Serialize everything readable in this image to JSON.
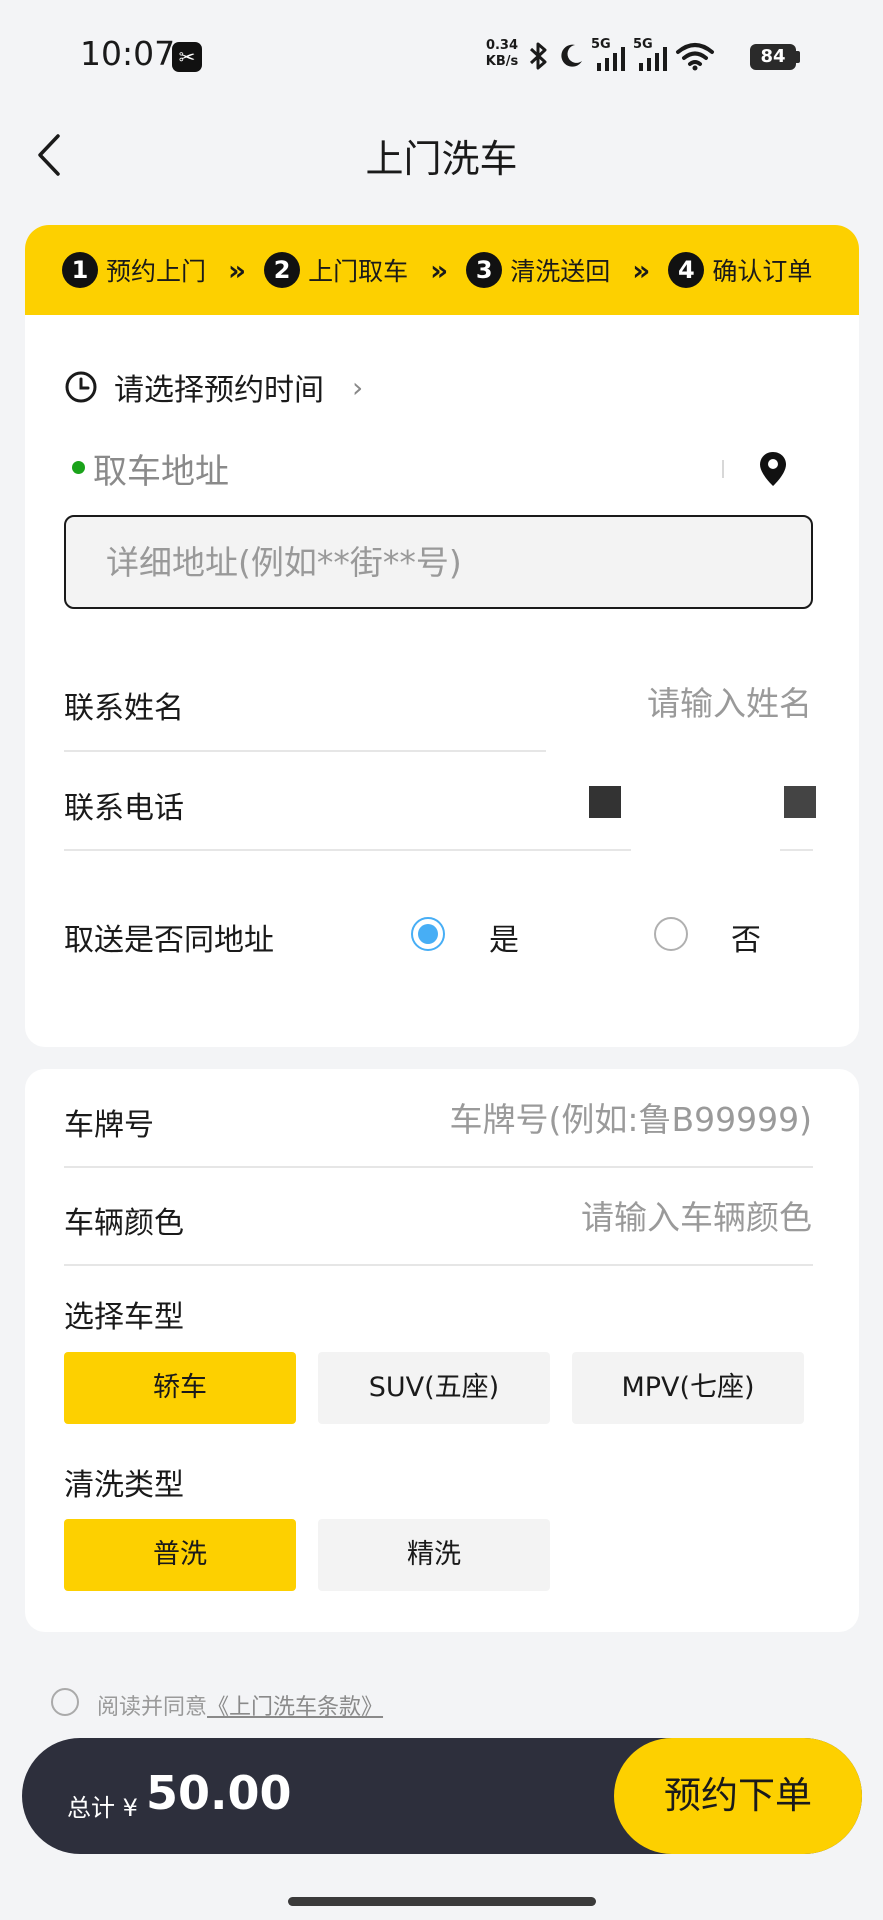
{
  "status_bar": {
    "time": "10:07",
    "app_icon": "scissors-icon",
    "net_speed_value": "0.34",
    "net_speed_unit": "KB/s",
    "signal_1_label": "5G",
    "signal_2_label": "5G",
    "battery": "84"
  },
  "header": {
    "title": "上门洗车"
  },
  "steps": [
    {
      "num": "1",
      "label": "预约上门"
    },
    {
      "num": "2",
      "label": "上门取车"
    },
    {
      "num": "3",
      "label": "清洗送回"
    },
    {
      "num": "4",
      "label": "确认订单"
    }
  ],
  "step_separator": "»",
  "appointment": {
    "time_placeholder": "请选择预约时间",
    "chevron": "›"
  },
  "pickup": {
    "address_label": "取车地址",
    "detail_placeholder": "详细地址(例如**街**号)"
  },
  "contact": {
    "name_label": "联系姓名",
    "name_placeholder": "请输入姓名",
    "phone_label": "联系电话"
  },
  "same_address": {
    "label": "取送是否同地址",
    "yes_label": "是",
    "no_label": "否",
    "selected": "是"
  },
  "vehicle": {
    "plate_label": "车牌号",
    "plate_placeholder": "车牌号(例如:鲁B99999)",
    "color_label": "车辆颜色",
    "color_placeholder": "请输入车辆颜色",
    "type_title": "选择车型",
    "types": [
      "轿车",
      "SUV(五座)",
      "MPV(七座)"
    ],
    "selected_type": "轿车",
    "wash_title": "清洗类型",
    "wash_types": [
      "普洗",
      "精洗"
    ],
    "selected_wash": "普洗"
  },
  "agreement": {
    "prefix": "阅读并同意",
    "link": "《上门洗车条款》"
  },
  "footer": {
    "total_label": "总计 ¥",
    "total_amount": "50.00",
    "submit_label": "预约下单"
  },
  "colors": {
    "accent": "#fdd000",
    "radio_selected": "#47aef5",
    "footer_bg": "#2d2f3c",
    "pickup_dot": "#1aa31a"
  }
}
